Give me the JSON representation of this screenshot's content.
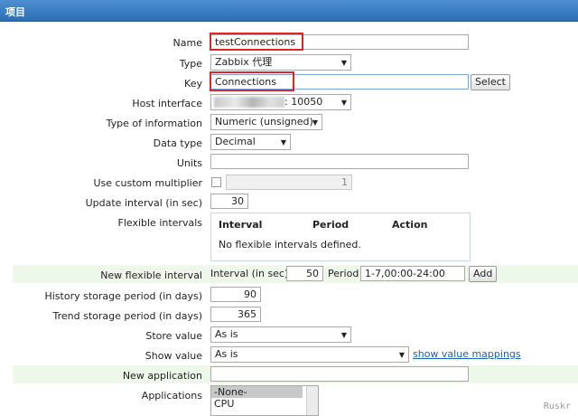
{
  "header": {
    "title": "项目"
  },
  "form": {
    "name": {
      "label": "Name",
      "value": "testConnections"
    },
    "type": {
      "label": "Type",
      "value": "Zabbix 代理"
    },
    "key": {
      "label": "Key",
      "value": "Connections",
      "button": "Select"
    },
    "host_interface": {
      "label": "Host interface",
      "value": ": 10050"
    },
    "type_of_information": {
      "label": "Type of information",
      "value": "Numeric (unsigned)"
    },
    "data_type": {
      "label": "Data type",
      "value": "Decimal"
    },
    "units": {
      "label": "Units",
      "value": ""
    },
    "custom_multiplier": {
      "label": "Use custom multiplier",
      "value": "1",
      "checked": false
    },
    "update_interval": {
      "label": "Update interval (in sec)",
      "value": "30"
    },
    "flexible_intervals": {
      "label": "Flexible intervals",
      "columns": [
        "Interval",
        "Period",
        "Action"
      ],
      "empty": "No flexible intervals defined."
    },
    "new_flexible_interval": {
      "label": "New flexible interval",
      "interval_label": "Interval (in sec)",
      "interval_value": "50",
      "period_label": "Period",
      "period_value": "1-7,00:00-24:00",
      "button": "Add"
    },
    "history": {
      "label": "History storage period (in days)",
      "value": "90"
    },
    "trend": {
      "label": "Trend storage period (in days)",
      "value": "365"
    },
    "store_value": {
      "label": "Store value",
      "value": "As is"
    },
    "show_value": {
      "label": "Show value",
      "value": "As is",
      "link": "show value mappings"
    },
    "new_application": {
      "label": "New application",
      "value": ""
    },
    "applications": {
      "label": "Applications",
      "options": [
        "-None-",
        "CPU"
      ]
    }
  },
  "watermark": "Ruskr",
  "colors": {
    "header": "#2c6fb3",
    "highlight_box": "#e0242c",
    "green_row": "#eef8ea",
    "link": "#1a62b3"
  }
}
